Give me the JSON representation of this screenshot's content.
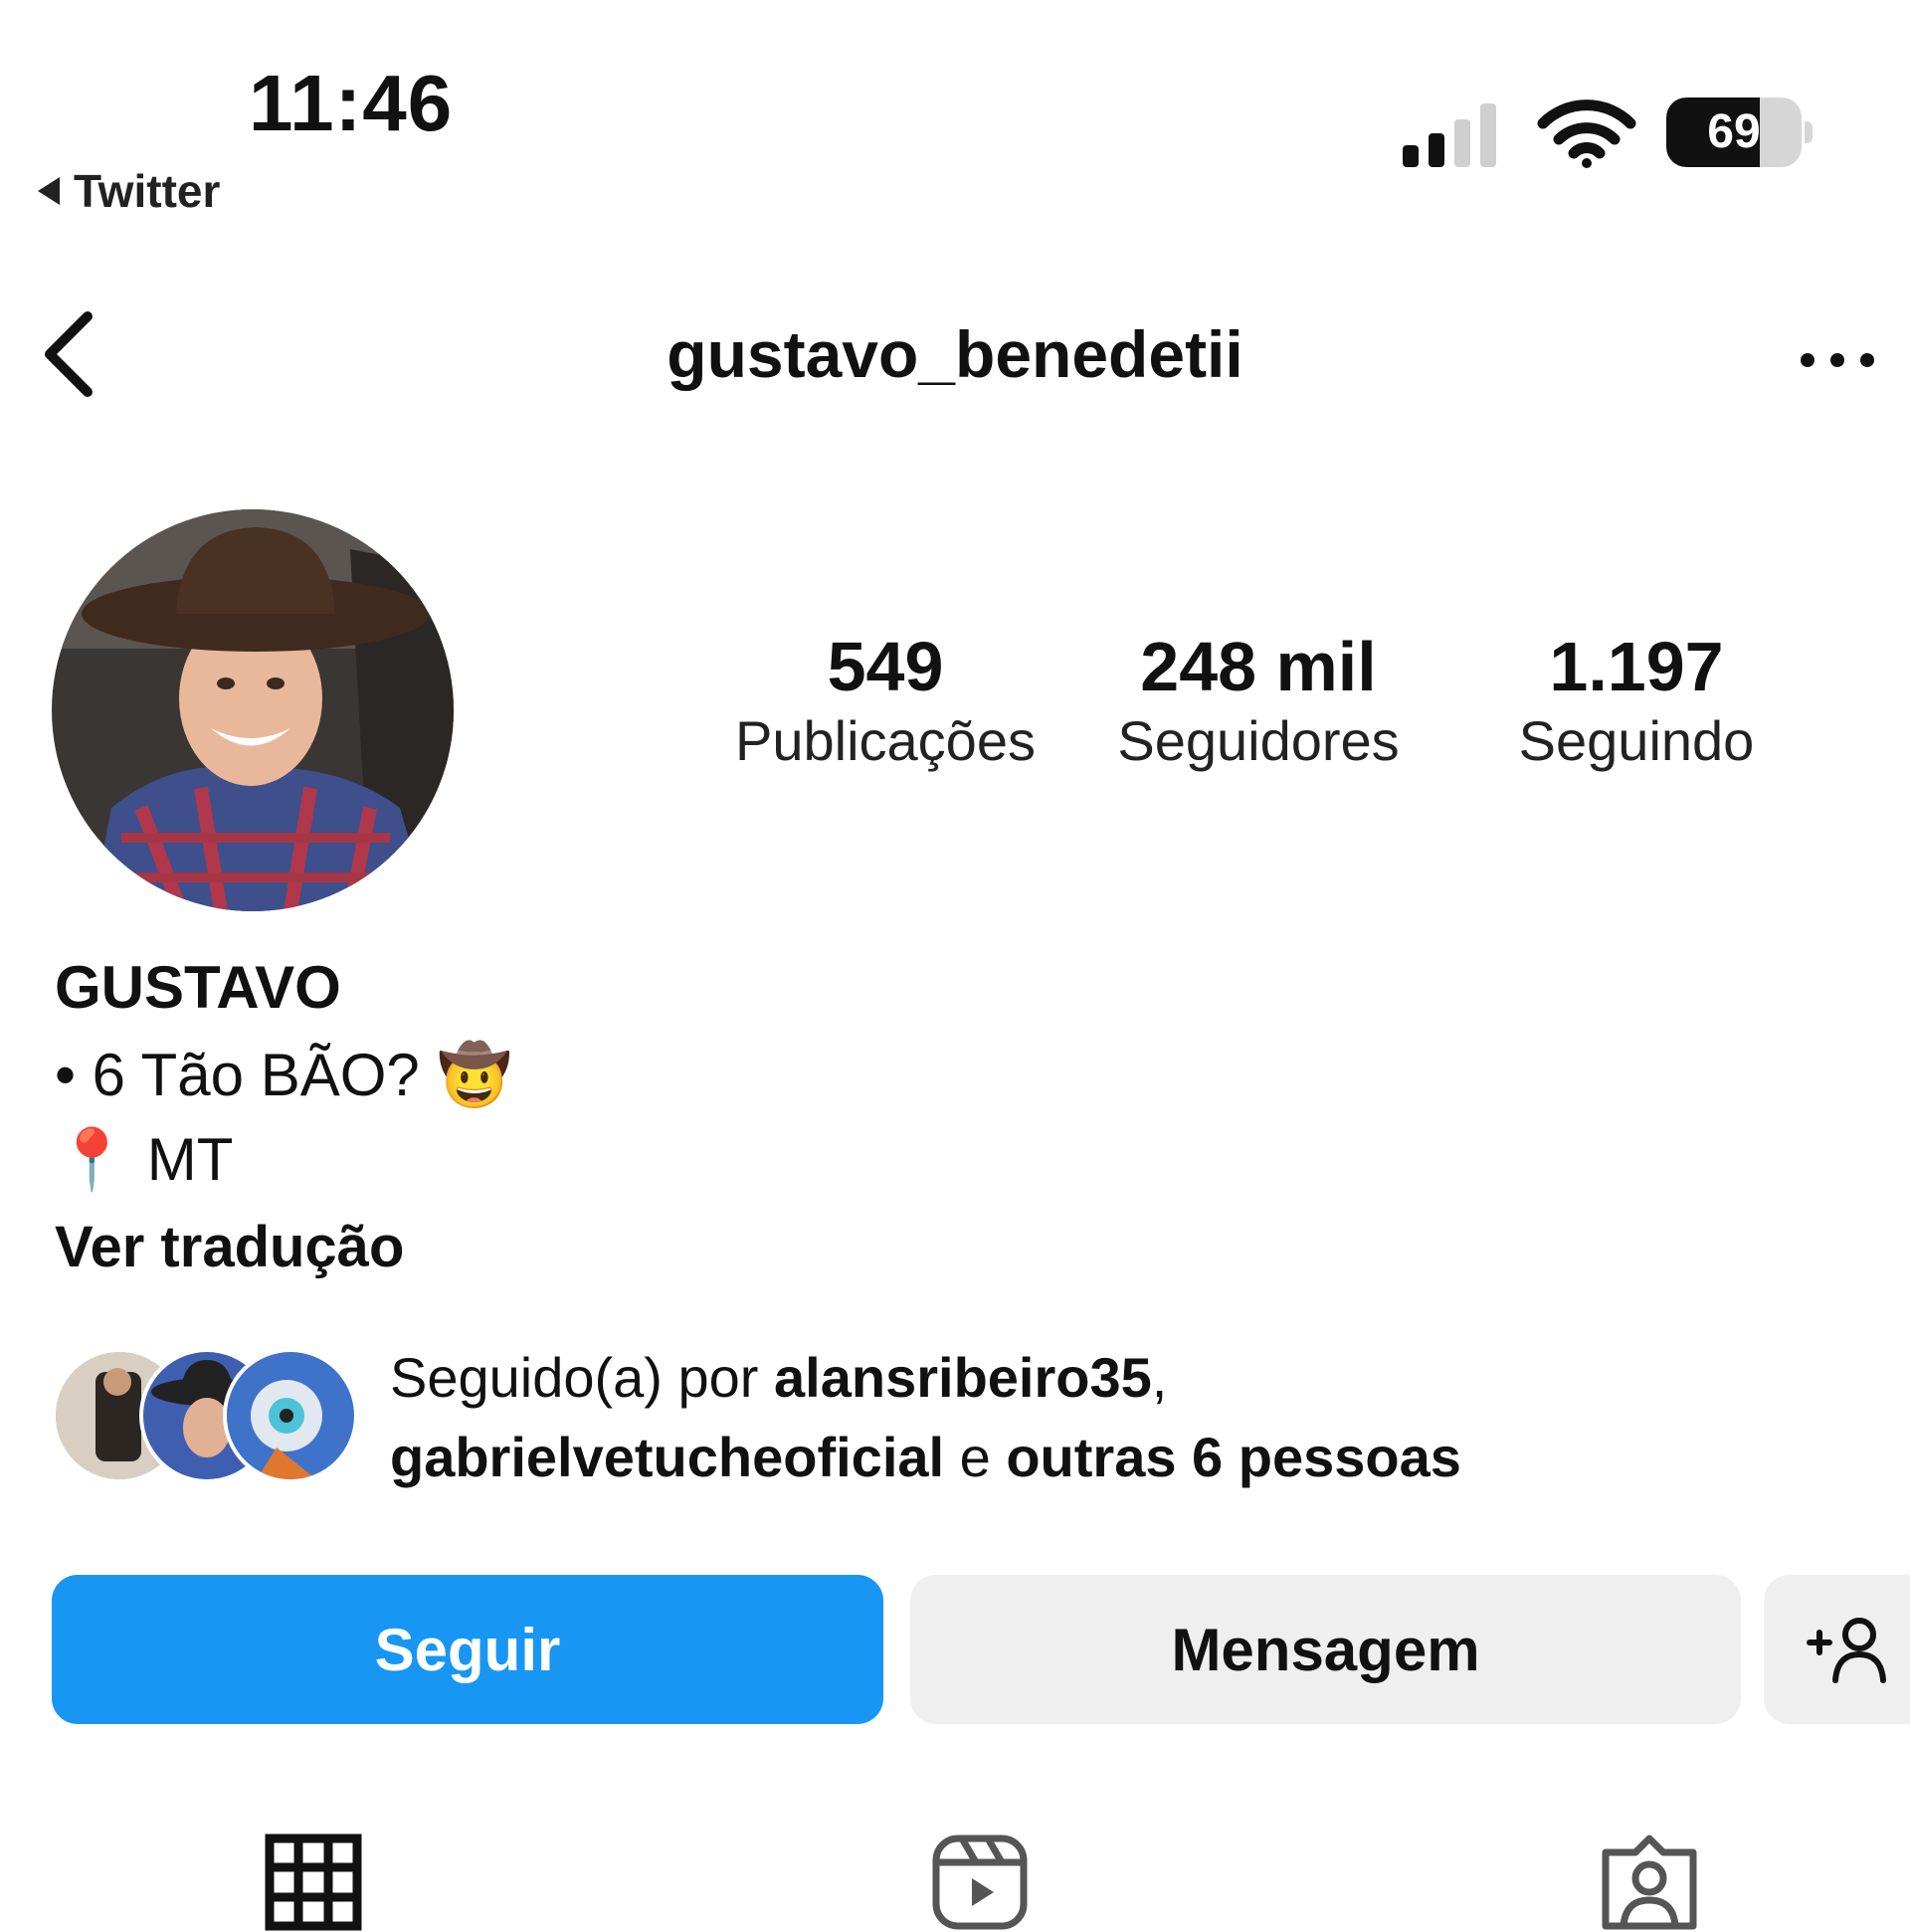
{
  "status_bar": {
    "time": "11:46",
    "back_app": "Twitter",
    "battery_level": "69"
  },
  "nav": {
    "username": "gustavo_benedetii"
  },
  "stats": {
    "posts": {
      "value": "549",
      "label": "Publicações"
    },
    "followers": {
      "value": "248 mil",
      "label": "Seguidores"
    },
    "following": {
      "value": "1.197",
      "label": "Seguindo"
    }
  },
  "bio": {
    "name": "GUSTAVO",
    "line1": "• 6 Tão BÃO?",
    "line1_emoji": "🤠",
    "line2_emoji": "📍",
    "line2": "MT",
    "translate": "Ver tradução"
  },
  "followed_by": {
    "prefix": "Seguido(a) por ",
    "user1": "alansribeiro35",
    "sep": ",",
    "user2": "gabrielvetucheoficial",
    "conj": " e ",
    "others": "outras 6 pessoas"
  },
  "buttons": {
    "follow": "Seguir",
    "message": "Mensagem"
  },
  "colors": {
    "follow_button": "#1796f3",
    "secondary_button": "#efefef"
  },
  "icons": [
    "back-chevron-icon",
    "more-icon",
    "add-person-icon",
    "grid-icon",
    "reels-icon",
    "tagged-icon"
  ]
}
